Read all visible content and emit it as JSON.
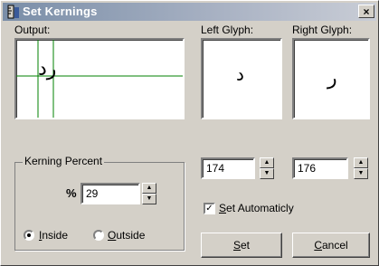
{
  "window": {
    "title": "Set Kernings",
    "close_label": "×",
    "title_icon": "ruler-icon"
  },
  "output": {
    "label": "Output:",
    "preview_text": "رد",
    "guide_color": "#008000"
  },
  "left_glyph": {
    "label": "Left Glyph:",
    "glyph": "د",
    "value": "174"
  },
  "right_glyph": {
    "label": "Right Glyph:",
    "glyph": "ر",
    "value": "176"
  },
  "kerning": {
    "group_label": "Kerning Percent",
    "percent_symbol": "%",
    "value": "29",
    "options": [
      {
        "label": "Inside",
        "accel": "I",
        "rest": "nside",
        "selected": true
      },
      {
        "label": "Outside",
        "accel": "O",
        "rest": "utside",
        "selected": false
      }
    ]
  },
  "auto": {
    "label": "Set Automaticly",
    "accel": "S",
    "rest": "et Automaticly",
    "checked": true
  },
  "buttons": {
    "set_accel": "S",
    "set_rest": "et",
    "cancel_accel": "C",
    "cancel_rest": "ancel"
  }
}
